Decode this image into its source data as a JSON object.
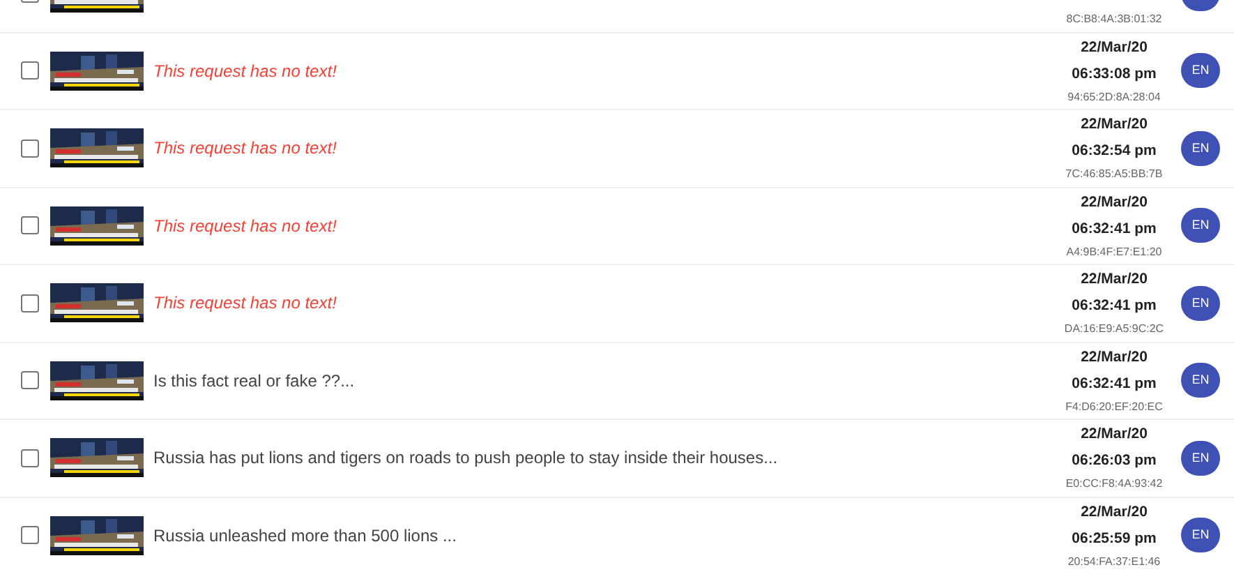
{
  "requests": [
    {
      "checked": false,
      "mac": "8C:B8:4A:3B:01:32"
    },
    {
      "checked": false,
      "text": "This request has no text!",
      "kind": "empty",
      "date": "22/Mar/20",
      "time": "06:33:08 pm",
      "mac": "94:65:2D:8A:28:04",
      "language": "EN"
    },
    {
      "checked": false,
      "text": "This request has no text!",
      "kind": "empty",
      "date": "22/Mar/20",
      "time": "06:32:54 pm",
      "mac": "7C:46:85:A5:BB:7B",
      "language": "EN"
    },
    {
      "checked": false,
      "text": "This request has no text!",
      "kind": "empty",
      "date": "22/Mar/20",
      "time": "06:32:41 pm",
      "mac": "A4:9B:4F:E7:E1:20",
      "language": "EN"
    },
    {
      "checked": false,
      "text": "This request has no text!",
      "kind": "empty",
      "date": "22/Mar/20",
      "time": "06:32:41 pm",
      "mac": "DA:16:E9:A5:9C:2C",
      "language": "EN"
    },
    {
      "checked": false,
      "text": "Is this fact real or fake ??...",
      "kind": "message",
      "date": "22/Mar/20",
      "time": "06:32:41 pm",
      "mac": "F4:D6:20:EF:20:EC",
      "language": "EN"
    },
    {
      "checked": false,
      "text": "Russia has put lions and tigers on roads to push people to stay inside their houses...",
      "kind": "message",
      "date": "22/Mar/20",
      "time": "06:26:03 pm",
      "mac": "E0:CC:F8:4A:93:42",
      "language": "EN"
    },
    {
      "checked": false,
      "text": "Russia unleashed more than 500 lions ...",
      "kind": "message",
      "date": "22/Mar/20",
      "time": "06:25:59 pm",
      "mac": "20:54:FA:37:E1:46",
      "language": "EN"
    }
  ]
}
